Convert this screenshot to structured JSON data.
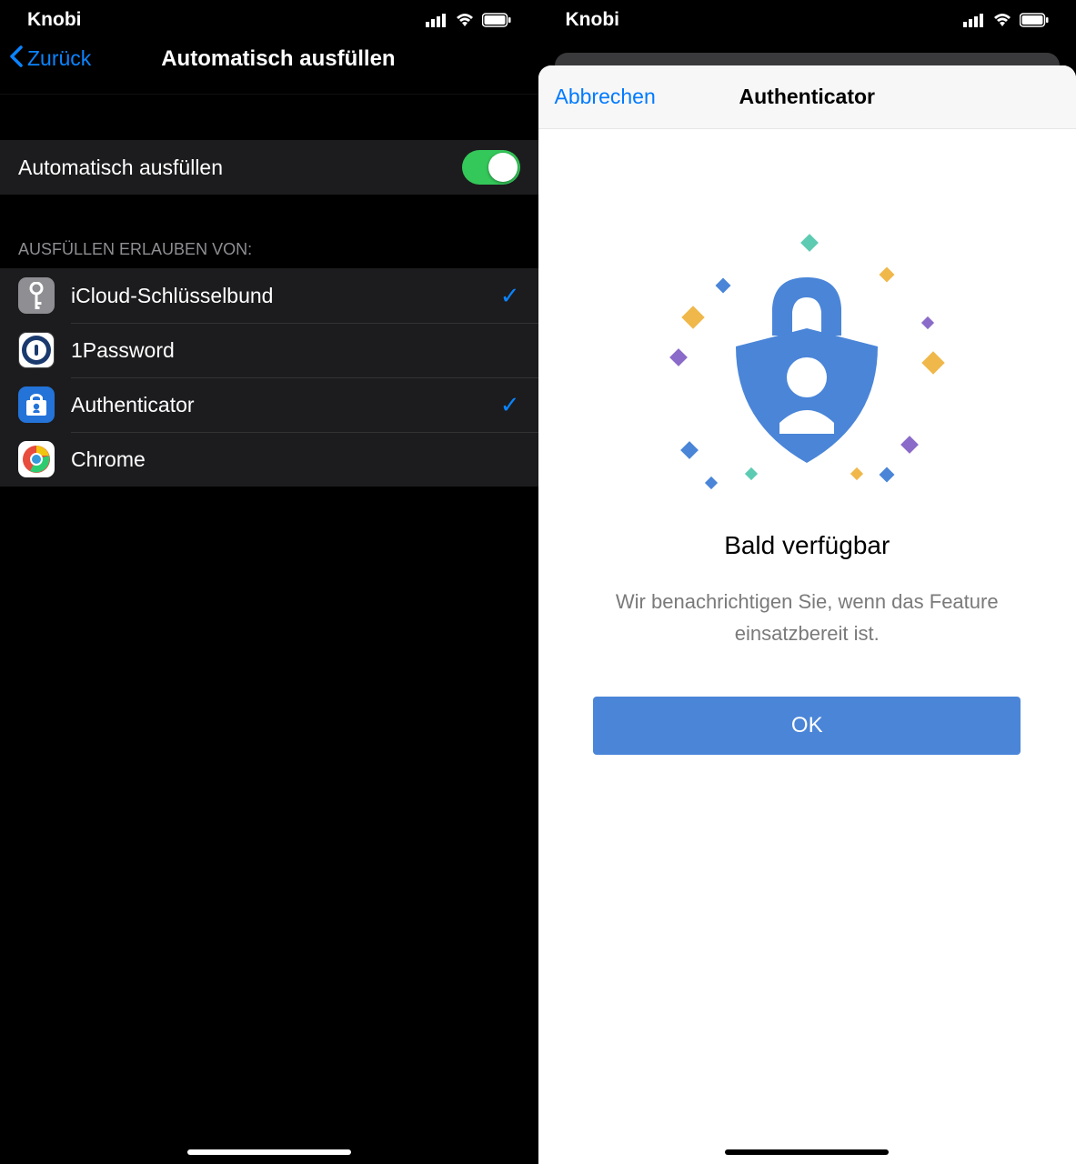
{
  "status": {
    "carrier": "Knobi"
  },
  "left": {
    "back_label": "Zurück",
    "title": "Automatisch ausfüllen",
    "toggle_label": "Automatisch ausfüllen",
    "section_header": "Ausfüllen erlauben von:",
    "items": [
      {
        "name": "iCloud-Schlüsselbund",
        "checked": true
      },
      {
        "name": "1Password",
        "checked": false
      },
      {
        "name": "Authenticator",
        "checked": true
      },
      {
        "name": "Chrome",
        "checked": false
      }
    ]
  },
  "right": {
    "cancel_label": "Abbrechen",
    "sheet_title": "Authenticator",
    "promo_title": "Bald verfügbar",
    "promo_sub": "Wir benachrichtigen Sie, wenn das Feature einsatzbereit ist.",
    "ok_label": "OK"
  }
}
